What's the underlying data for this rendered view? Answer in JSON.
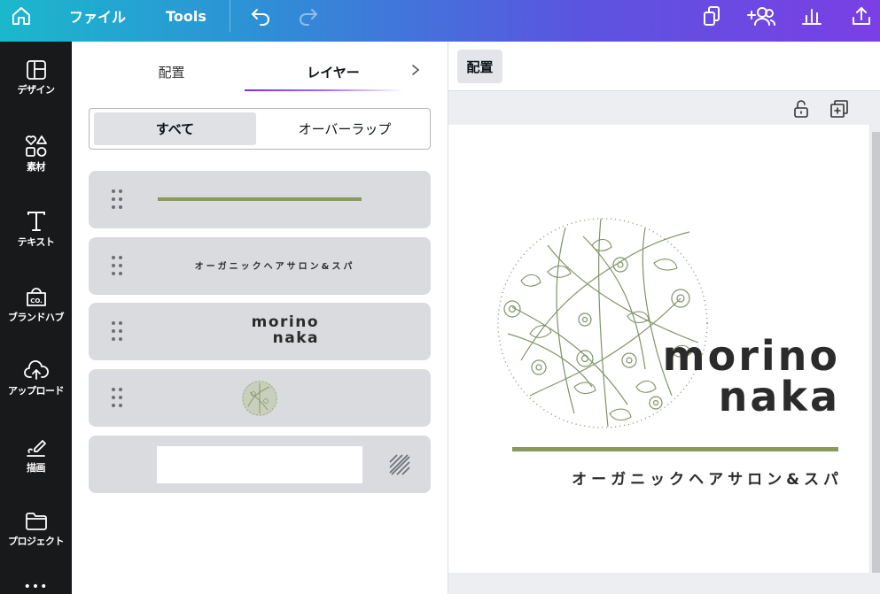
{
  "topbar": {
    "file_label": "ファイル",
    "tools_label": "Tools"
  },
  "rail": {
    "items": [
      {
        "label": "デザイン",
        "icon": "layout-icon"
      },
      {
        "label": "素材",
        "icon": "elements-icon"
      },
      {
        "label": "テキスト",
        "icon": "text-icon"
      },
      {
        "label": "ブランドハブ",
        "icon": "brand-hub-icon"
      },
      {
        "label": "アップロード",
        "icon": "upload-cloud-icon"
      },
      {
        "label": "描画",
        "icon": "draw-icon"
      },
      {
        "label": "プロジェクト",
        "icon": "folder-icon"
      }
    ],
    "more": "•••"
  },
  "panel": {
    "tabs": [
      {
        "label": "配置"
      },
      {
        "label": "レイヤー"
      }
    ],
    "active_tab": 1,
    "filter": {
      "all": "すべて",
      "overlap": "オーバーラップ"
    },
    "layers": [
      {
        "type": "line",
        "color": "#8a9a5b"
      },
      {
        "type": "text",
        "text": "オーガニックヘアサロン&スパ"
      },
      {
        "type": "text",
        "line1": "morino",
        "line2": "naka"
      },
      {
        "type": "image",
        "icon": "floral-circle-thumbnail"
      },
      {
        "type": "background",
        "icon": "transparency-icon"
      }
    ]
  },
  "canvas": {
    "position_button": "配置",
    "logo": {
      "line1": "morino",
      "line2": "naka",
      "subtitle": "オーガニックヘアサロン&スパ",
      "accent_color": "#8a9a5b",
      "illustration_color": "#7f9468"
    }
  },
  "colors": {
    "topbar_gradient_start": "#1bb8cc",
    "topbar_gradient_end": "#7b3fe4",
    "rail_bg": "#18191b",
    "active_tab_underline": "#7d2ae8"
  }
}
